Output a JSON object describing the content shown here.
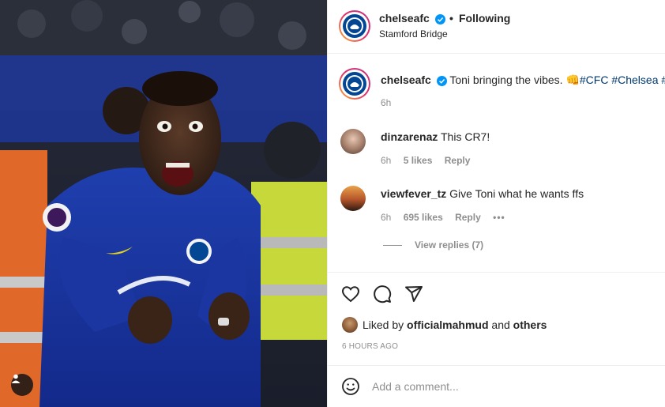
{
  "header": {
    "username": "chelseafc",
    "separator": "•",
    "follow_status": "Following",
    "location": "Stamford Bridge"
  },
  "caption": {
    "username": "chelseafc",
    "text": "Toni bringing the vibes. 👊",
    "hashtags": "#CFC #Chelsea #",
    "time": "6h"
  },
  "comments": [
    {
      "username": "dinzarenaz",
      "text": "This CR7!",
      "time": "6h",
      "likes": "5 likes",
      "reply": "Reply"
    },
    {
      "username": "viewfever_tz",
      "text": "Give Toni what he wants ffs",
      "time": "6h",
      "likes": "695 likes",
      "reply": "Reply",
      "more": "•••"
    }
  ],
  "view_replies": "View replies (7)",
  "likes": {
    "prefix": "Liked by",
    "user": "officialmahmud",
    "conj": "and",
    "others": "others"
  },
  "timestamp": "6 HOURS AGO",
  "add_comment": {
    "placeholder": "Add a comment..."
  },
  "colors": {
    "accent": "#0095f6",
    "chelsea_blue": "#034694",
    "text": "#262626",
    "muted": "#8e8e8e",
    "link": "#00376b"
  }
}
